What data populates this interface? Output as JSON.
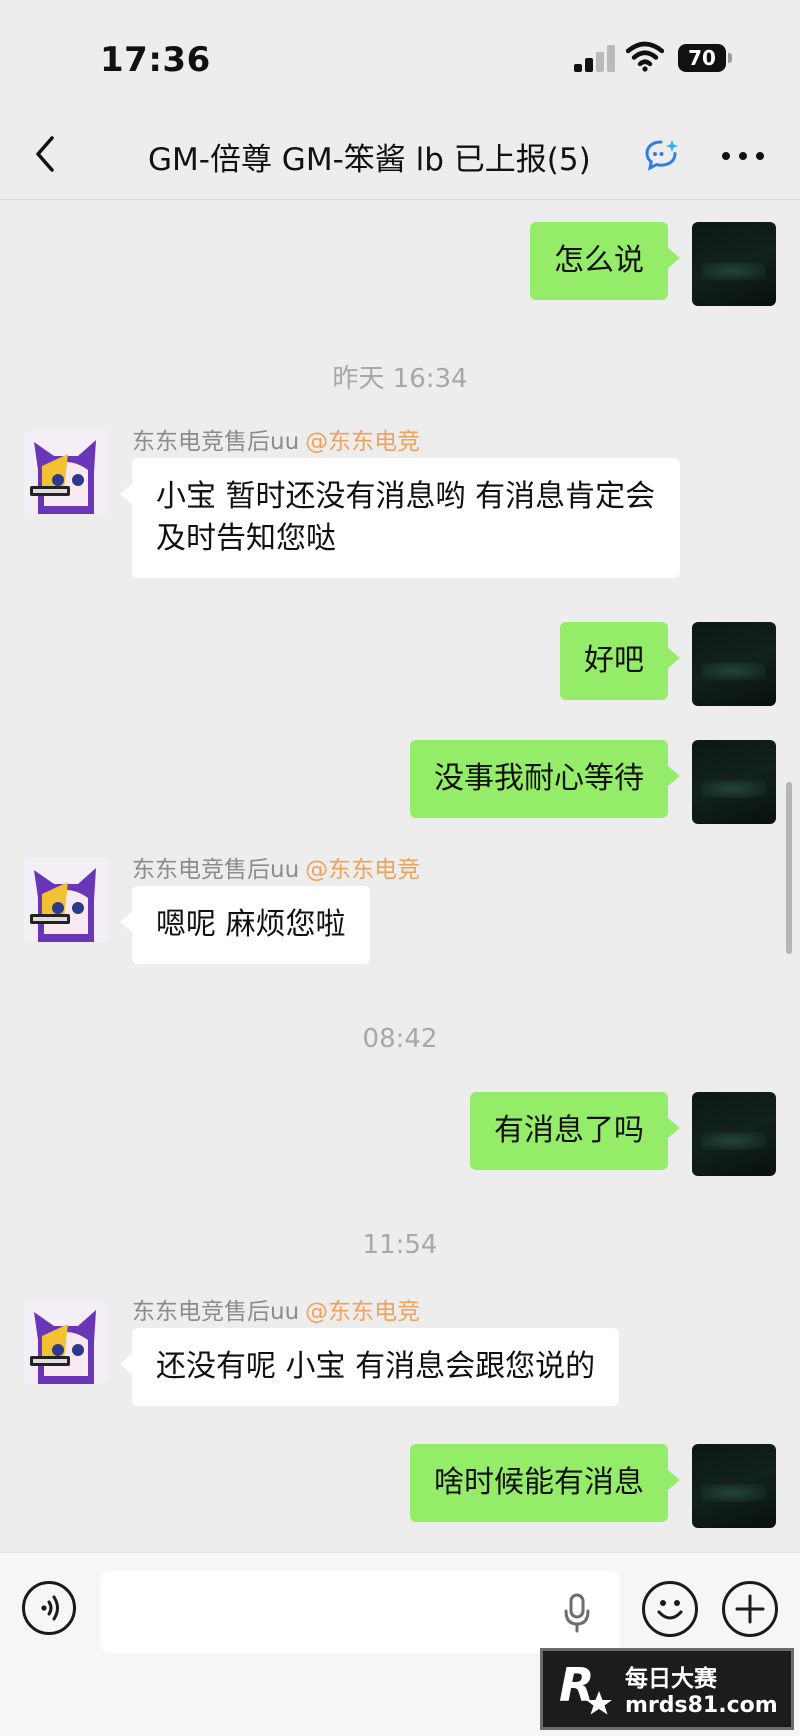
{
  "status_bar": {
    "time": "17:36",
    "battery": "70"
  },
  "nav": {
    "title": "GM-倍尊 GM-笨酱 lb 已上报(5)"
  },
  "agent": {
    "name": "东东电竞售后uu",
    "tag": "@东东电竞"
  },
  "messages": [
    {
      "type": "out",
      "text": "怎么说"
    },
    {
      "type": "time",
      "text": "昨天 16:34"
    },
    {
      "type": "in",
      "text": "小宝 暂时还没有消息哟 有消息肯定会及时告知您哒"
    },
    {
      "type": "out",
      "text": "好吧"
    },
    {
      "type": "out",
      "text": "没事我耐心等待"
    },
    {
      "type": "in",
      "text": "嗯呢 麻烦您啦"
    },
    {
      "type": "time",
      "text": "08:42"
    },
    {
      "type": "out",
      "text": "有消息了吗"
    },
    {
      "type": "time",
      "text": "11:54"
    },
    {
      "type": "in",
      "text": "还没有呢 小宝 有消息会跟您说的"
    },
    {
      "type": "out",
      "text": "啥时候能有消息"
    }
  ],
  "input": {
    "placeholder": ""
  },
  "watermark": {
    "name": "每日大赛",
    "url": "mrds81.com",
    "logo_letter": "R"
  },
  "colors": {
    "outgoing_bubble": "#95ec69",
    "incoming_bubble": "#ffffff",
    "background": "#ededed",
    "sender_tag": "#f0a25a"
  },
  "icons": [
    "back-icon",
    "chat-assist-icon",
    "more-icon",
    "voice-icon",
    "mic-icon",
    "emoji-icon",
    "add-icon",
    "signal-icon",
    "wifi-icon",
    "battery-icon"
  ]
}
